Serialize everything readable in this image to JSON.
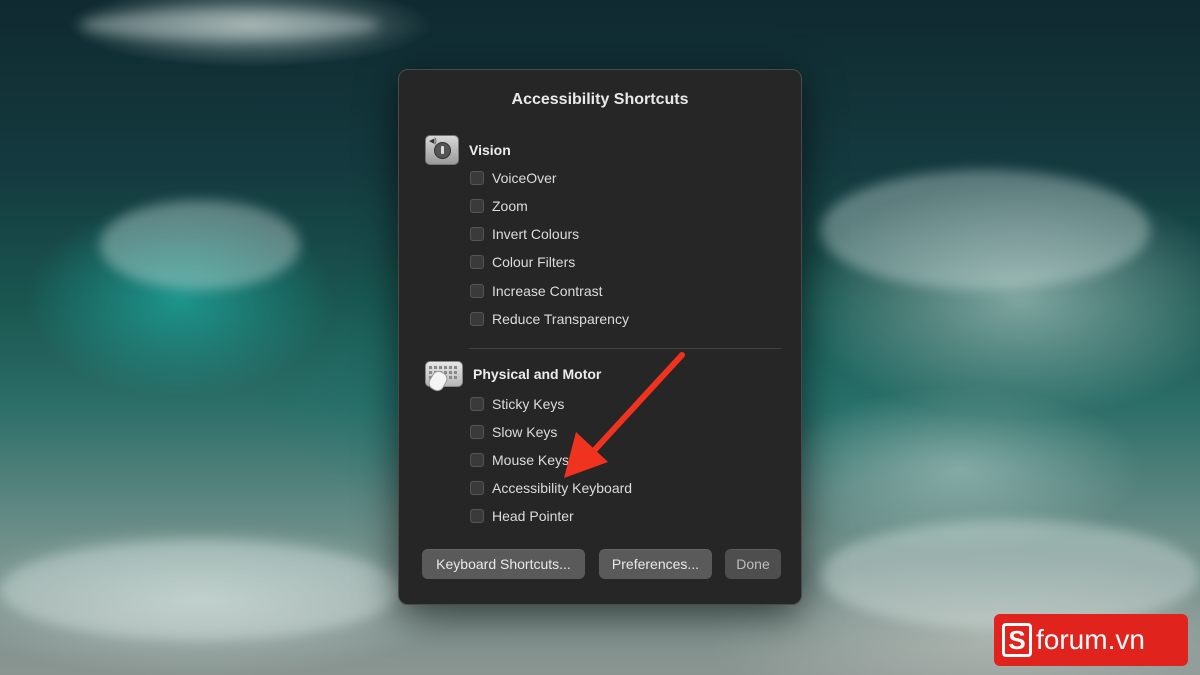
{
  "dialog": {
    "title": "Accessibility Shortcuts",
    "sections": [
      {
        "label": "Vision",
        "icon": "vision-accessibility-icon",
        "items": [
          "VoiceOver",
          "Zoom",
          "Invert Colours",
          "Colour Filters",
          "Increase Contrast",
          "Reduce Transparency"
        ]
      },
      {
        "label": "Physical and Motor",
        "icon": "keyboard-mouse-icon",
        "items": [
          "Sticky Keys",
          "Slow Keys",
          "Mouse Keys",
          "Accessibility Keyboard",
          "Head Pointer"
        ]
      }
    ],
    "buttons": {
      "keyboard_shortcuts": "Keyboard Shortcuts...",
      "preferences": "Preferences...",
      "done": "Done"
    }
  },
  "colors": {
    "dialog_bg": "#262626",
    "arrow": "#f0331f",
    "logo_bg": "#e0231c"
  },
  "watermark": {
    "brand_letter": "S",
    "text": "forum.vn"
  }
}
